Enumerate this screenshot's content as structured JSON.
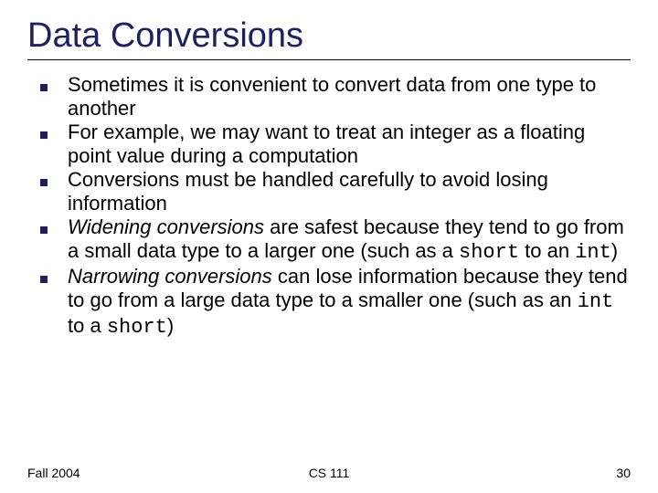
{
  "title": "Data Conversions",
  "bullets": [
    {
      "segs": [
        {
          "t": "Sometimes it is convenient to convert data from one type to another"
        }
      ]
    },
    {
      "segs": [
        {
          "t": "For example, we may want to treat an integer as a floating point value during a computation"
        }
      ]
    },
    {
      "segs": [
        {
          "t": "Conversions must be handled carefully to avoid losing information"
        }
      ]
    },
    {
      "segs": [
        {
          "t": "Widening conversions",
          "italic": true
        },
        {
          "t": " are safest because they tend to go from a small data type to a larger one (such as a "
        },
        {
          "t": "short",
          "mono": true
        },
        {
          "t": " to an "
        },
        {
          "t": "int",
          "mono": true
        },
        {
          "t": ")"
        }
      ]
    },
    {
      "segs": [
        {
          "t": "Narrowing conversions",
          "italic": true
        },
        {
          "t": " can lose information because they tend to go from a large data type to a smaller one (such as an "
        },
        {
          "t": "int",
          "mono": true
        },
        {
          "t": " to a "
        },
        {
          "t": "short",
          "mono": true
        },
        {
          "t": ")"
        }
      ]
    }
  ],
  "footer": {
    "left": "Fall 2004",
    "center": "CS 111",
    "right": "30"
  }
}
